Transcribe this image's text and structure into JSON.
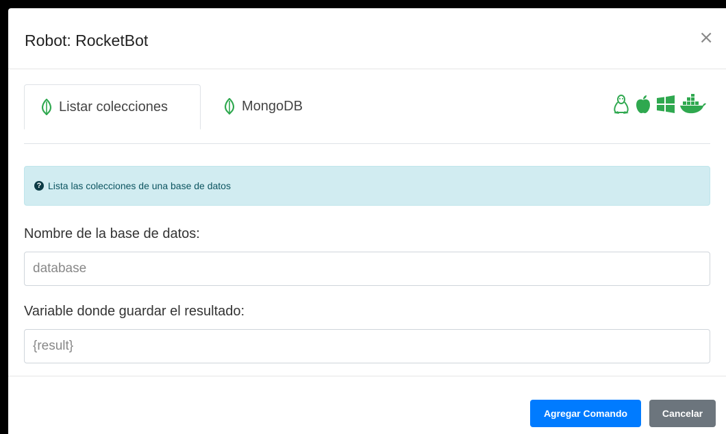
{
  "modal": {
    "title": "Robot: RocketBot",
    "close_label": "×"
  },
  "tabs": [
    {
      "label": "Listar colecciones",
      "icon": "mongodb-leaf-icon",
      "active": true
    },
    {
      "label": "MongoDB",
      "icon": "mongodb-leaf-icon",
      "active": false
    }
  ],
  "os_icons": [
    "linux-icon",
    "apple-icon",
    "windows-icon",
    "docker-icon"
  ],
  "info": {
    "icon": "question-circle-icon",
    "text": "Lista las colecciones de una base de datos"
  },
  "fields": {
    "database": {
      "label": "Nombre de la base de datos:",
      "placeholder": "database"
    },
    "result": {
      "label": "Variable donde guardar el resultado:",
      "placeholder": "{result}"
    }
  },
  "footer": {
    "add_label": "Agregar Comando",
    "cancel_label": "Cancelar"
  },
  "colors": {
    "accent_green": "#2fa84f",
    "primary": "#007bff",
    "secondary": "#6c757d",
    "info_bg": "#d1ecf1"
  }
}
